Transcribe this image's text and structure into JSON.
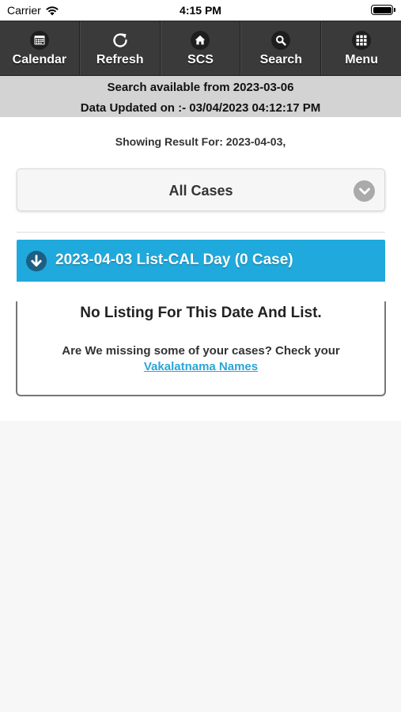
{
  "status_bar": {
    "carrier": "Carrier",
    "time": "4:15 PM",
    "icons": [
      "wifi-icon",
      "battery-icon"
    ]
  },
  "toolbar": {
    "items": [
      {
        "label": "Calendar",
        "icon": "calendar-icon"
      },
      {
        "label": "Refresh",
        "icon": "refresh-icon"
      },
      {
        "label": "SCS",
        "icon": "home-icon"
      },
      {
        "label": "Search",
        "icon": "search-icon"
      },
      {
        "label": "Menu",
        "icon": "grid-icon"
      }
    ]
  },
  "info": {
    "search_available": "Search available from 2023-03-06",
    "data_updated": "Data Updated on :- 03/04/2023 04:12:17 PM"
  },
  "main": {
    "showing_result": "Showing Result For: 2023-04-03,",
    "case_filter": {
      "selected": "All Cases",
      "icon": "chevron-down-icon"
    },
    "list_header": {
      "title": "2023-04-03 List-CAL Day (0 Case)",
      "icon": "arrow-down-icon"
    },
    "result": {
      "message": "No Listing For This Date And List.",
      "missing_prompt": "Are We missing some of your cases? Check your",
      "link_label": "Vakalatnama Names"
    }
  },
  "colors": {
    "toolbar_bg": "#3a3a3a",
    "banner_bg": "#d3d3d3",
    "accent": "#1fa9dc",
    "link": "#2aa5d8"
  }
}
